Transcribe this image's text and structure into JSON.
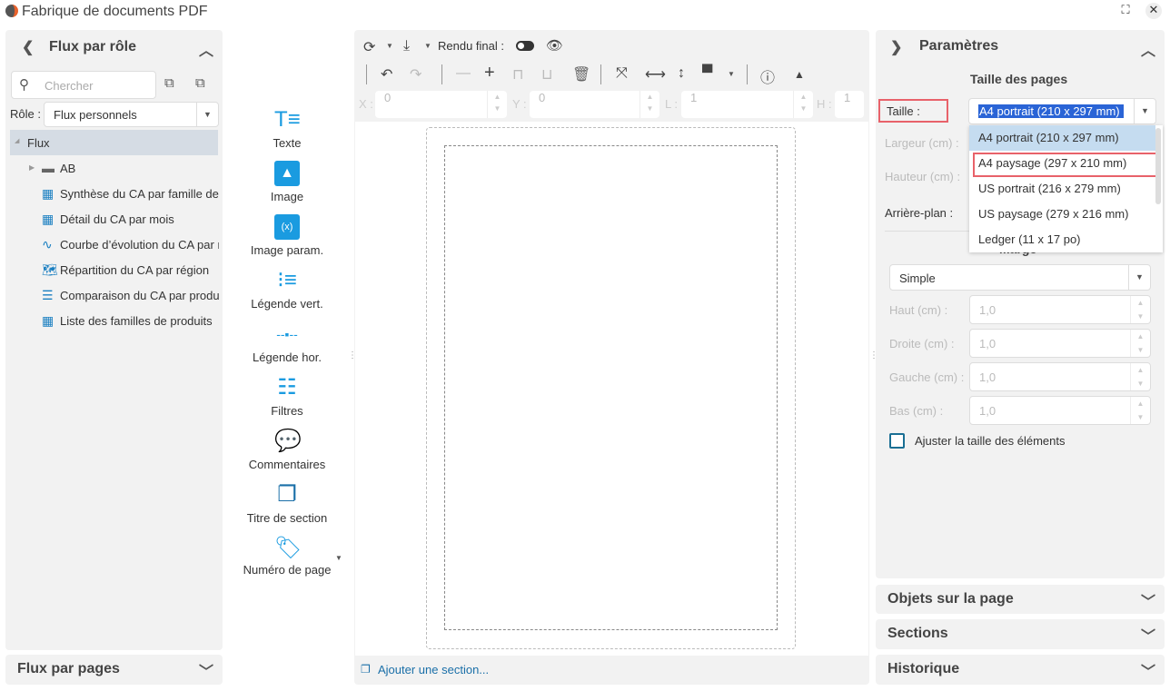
{
  "window": {
    "title": "Fabrique de documents PDF"
  },
  "left": {
    "title": "Flux par rôle",
    "search_placeholder": "Chercher",
    "role_label": "Rôle :",
    "role_value": "Flux personnels",
    "tree_root": "Flux",
    "items": [
      {
        "label": "AB",
        "icon": "folder-icon"
      },
      {
        "label": "Synthèse du CA par famille de produits",
        "icon": "table-icon"
      },
      {
        "label": "Détail du CA par mois",
        "icon": "table-icon"
      },
      {
        "label": "Courbe d’évolution du CA par mois",
        "icon": "line-chart-icon"
      },
      {
        "label": "Répartition du CA par région",
        "icon": "map-icon"
      },
      {
        "label": "Comparaison du CA par produit",
        "icon": "bar-chart-icon"
      },
      {
        "label": "Liste des familles de produits",
        "icon": "grid-icon"
      }
    ],
    "bottom_title": "Flux par pages"
  },
  "palette": [
    "Texte",
    "Image",
    "Image param.",
    "Légende vert.",
    "Légende hor.",
    "Filtres",
    "Commentaires",
    "Titre de section",
    "Numéro de page"
  ],
  "toolbar": {
    "final_render_label": "Rendu final :",
    "x_label": "X :",
    "x_value": "0",
    "y_label": "Y :",
    "y_value": "0",
    "l_label": "L :",
    "l_value": "1",
    "h_label": "H :",
    "h_value": "1"
  },
  "canvas": {
    "add_section": "Ajouter une section..."
  },
  "params": {
    "title": "Paramètres",
    "section_title": "Taille des pages",
    "size_label": "Taille :",
    "size_value": "A4 portrait (210 x 297 mm)",
    "size_options": [
      "A4 portrait (210 x 297 mm)",
      "A4 paysage (297 x 210 mm)",
      "US portrait (216 x 279 mm)",
      "US paysage (279 x 216 mm)",
      "Ledger (11 x 17 po)"
    ],
    "width_label": "Largeur (cm) :",
    "height_label": "Hauteur (cm) :",
    "background_label": "Arrière-plan :",
    "margin_title": "Marge",
    "margin_type": "Simple",
    "margins": [
      {
        "label": "Haut (cm) :",
        "value": "1,0"
      },
      {
        "label": "Droite (cm) :",
        "value": "1,0"
      },
      {
        "label": "Gauche (cm) :",
        "value": "1,0"
      },
      {
        "label": "Bas (cm) :",
        "value": "1,0"
      }
    ],
    "adjust_label": "Ajuster la taille des éléments"
  },
  "collapsed_panels": [
    "Objets sur la page",
    "Sections",
    "Historique"
  ],
  "colors": {
    "accent": "#1a9be0",
    "highlight_box": "#e8626a",
    "selected_option": "#c5dcf0",
    "selection": "#2a64d6"
  }
}
